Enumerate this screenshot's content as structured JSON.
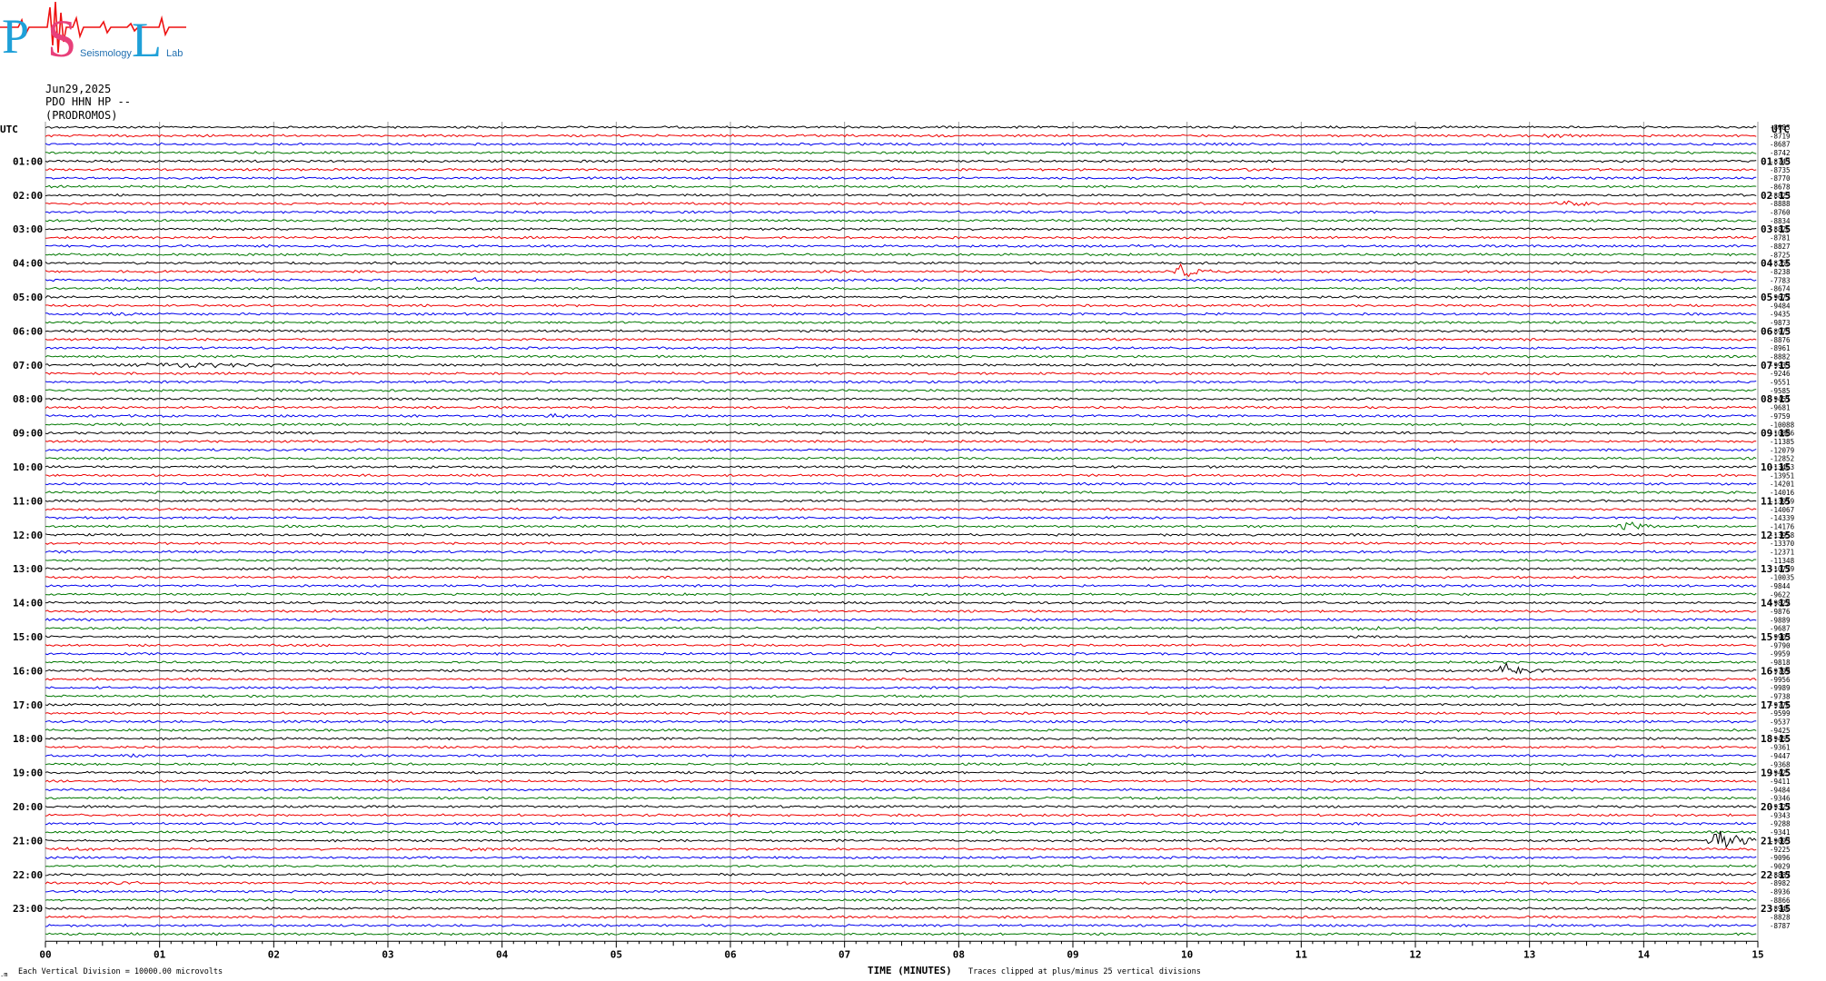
{
  "logo": {
    "letters": [
      "P",
      "S",
      "L"
    ],
    "words": [
      "Seismology",
      "Lab"
    ],
    "colors": {
      "p": "#1fa0d8",
      "s": "#e8407a",
      "l": "#1fa0d8",
      "wave": "#ee1111"
    }
  },
  "header": {
    "date": "Jun29,2025",
    "station": "PDO HHN HP --",
    "name": "(PRODROMOS)"
  },
  "left_axis_label": "UTC",
  "right_axis_label": "UTC",
  "left_time_labels": [
    "01:00",
    "02:00",
    "03:00",
    "04:00",
    "05:00",
    "06:00",
    "07:00",
    "08:00",
    "09:00",
    "10:00",
    "11:00",
    "12:00",
    "13:00",
    "14:00",
    "15:00",
    "16:00",
    "17:00",
    "18:00",
    "19:00",
    "20:00",
    "21:00",
    "22:00",
    "23:00"
  ],
  "right_time_labels": [
    "01:15",
    "02:15",
    "03:15",
    "04:15",
    "05:15",
    "06:15",
    "07:15",
    "08:15",
    "09:15",
    "10:15",
    "11:15",
    "12:15",
    "13:15",
    "14:15",
    "15:15",
    "16:15",
    "17:15",
    "18:15",
    "19:15",
    "20:15",
    "21:15",
    "22:15",
    "23:15"
  ],
  "x_tick_labels": [
    "00",
    "01",
    "02",
    "03",
    "04",
    "05",
    "06",
    "07",
    "08",
    "09",
    "10",
    "11",
    "12",
    "13",
    "14",
    "15"
  ],
  "footer": {
    "division": "Each Vertical Division = 10000.00 microvolts",
    "xlabel": "TIME (MINUTES)",
    "clip_note": "Traces clipped at plus/minus 25 vertical divisions",
    "corner_mark": ".m"
  },
  "trace_colors": [
    "#000000",
    "#ee0000",
    "#0000ee",
    "#007700"
  ],
  "chart_data": {
    "type": "line",
    "title": "",
    "xlabel": "TIME (MINUTES)",
    "ylabel": "UTC",
    "xlim": [
      0,
      15
    ],
    "rows": 96,
    "minutes_per_row": 15,
    "grid": true,
    "offsets": [
      "-8683",
      "-8719",
      "-8687",
      "-8742",
      "-8743",
      "-8735",
      "-8770",
      "-8678",
      "-8823",
      "-8888",
      "-8760",
      "-8834",
      "-8826",
      "-8781",
      "-8827",
      "-8725",
      "-8256",
      "-8238",
      "-7783",
      "-8674",
      "-9677",
      "-9484",
      "-9435",
      "-9873",
      "-8973",
      "-8876",
      "-8961",
      "-8882",
      "-9933",
      "-9246",
      "-9551",
      "-9585",
      "-9451",
      "-9681",
      "-9759",
      "-10088",
      "-10886",
      "-11385",
      "-12079",
      "-12852",
      "-13463",
      "-13951",
      "-14201",
      "-14016",
      "-13919",
      "-14067",
      "-14339",
      "-14176",
      "-13958",
      "-13370",
      "-12371",
      "-11348",
      "-10779",
      "-10035",
      "-9844",
      "-9622",
      "-9822",
      "-9876",
      "-9889",
      "-9687",
      "-9903",
      "-9790",
      "-9959",
      "-9818",
      "-9799",
      "-9956",
      "-9989",
      "-9738",
      "-9776",
      "-9599",
      "-9537",
      "-9425",
      "-9455",
      "-9361",
      "-9447",
      "-9368",
      "-9425",
      "-9411",
      "-9484",
      "-9346",
      "-9327",
      "-9343",
      "-9288",
      "-9341",
      "-9093",
      "-9225",
      "-9096",
      "-9029",
      "-8887",
      "-8982",
      "-8936",
      "-8866",
      "-8946",
      "-8828",
      "-8787"
    ],
    "events": [
      {
        "row": 1,
        "minute": 13.2,
        "amp": 2.2
      },
      {
        "row": 5,
        "minute": 10.5,
        "amp": 2.5
      },
      {
        "row": 9,
        "minute": 13.3,
        "amp": 4
      },
      {
        "row": 17,
        "minute": 9.95,
        "amp": 9
      },
      {
        "row": 18,
        "minute": 3.7,
        "amp": 2.5
      },
      {
        "row": 22,
        "minute": 0.6,
        "amp": 1.6
      },
      {
        "row": 28,
        "minute": 1.2,
        "amp": 2.8,
        "len": 2.0
      },
      {
        "row": 34,
        "minute": 4.4,
        "amp": 2.5
      },
      {
        "row": 41,
        "minute": 1.7,
        "amp": 2.5
      },
      {
        "row": 47,
        "minute": 13.85,
        "amp": 6
      },
      {
        "row": 59,
        "minute": 11.5,
        "amp": 4
      },
      {
        "row": 64,
        "minute": 12.8,
        "amp": 10
      },
      {
        "row": 74,
        "minute": 0.75,
        "amp": 1.8
      },
      {
        "row": 78,
        "minute": 13.1,
        "amp": 1.5
      },
      {
        "row": 81,
        "minute": 6.0,
        "amp": 1.5
      },
      {
        "row": 84,
        "minute": 14.65,
        "amp": 14,
        "len": 0.6
      },
      {
        "row": 85,
        "minute": 0.2,
        "amp": 2.5,
        "len": 0.5
      },
      {
        "row": 85,
        "minute": 3.7,
        "amp": 3
      },
      {
        "row": 89,
        "minute": 0.6,
        "amp": 3
      }
    ]
  }
}
